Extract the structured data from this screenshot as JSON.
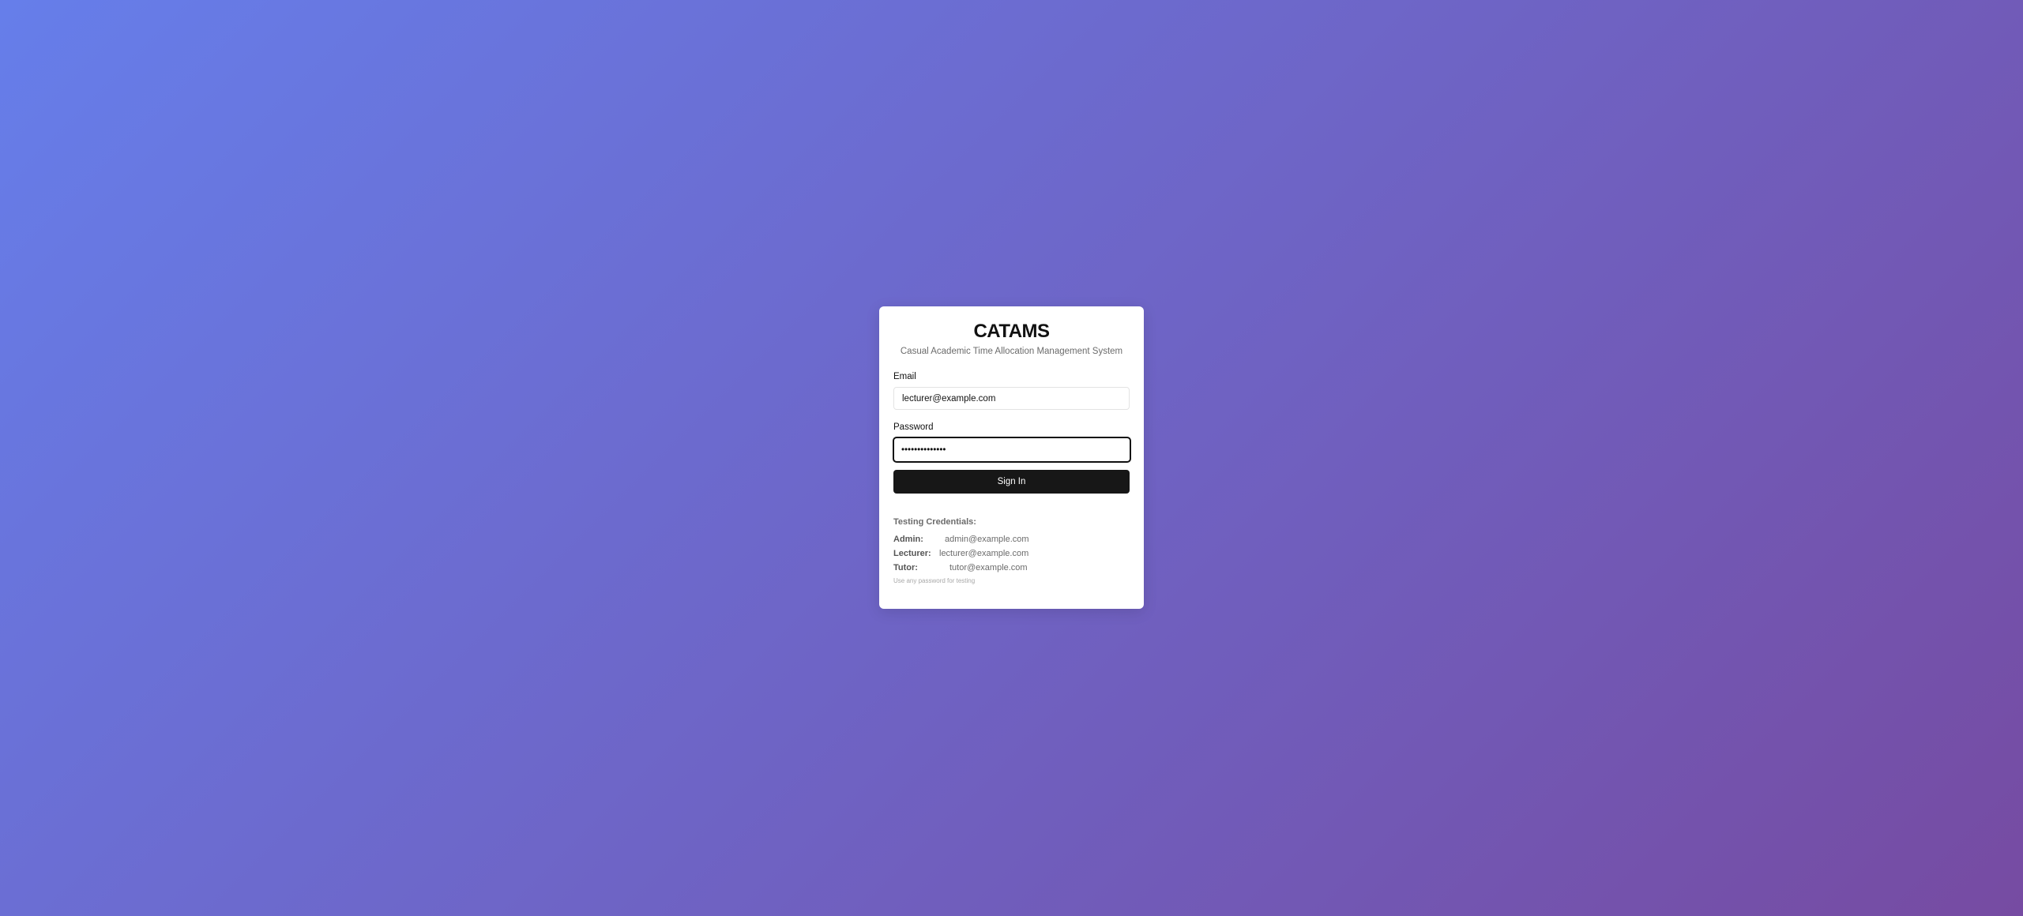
{
  "app": {
    "title": "CATAMS",
    "subtitle": "Casual Academic Time Allocation Management System"
  },
  "form": {
    "email_label": "Email",
    "email_value": "lecturer@example.com",
    "password_label": "Password",
    "password_value": "••••••••••••••",
    "submit_label": "Sign In"
  },
  "credentials": {
    "heading": "Testing Credentials:",
    "items": [
      {
        "role": "Admin:",
        "email": "admin@example.com"
      },
      {
        "role": "Lecturer:",
        "email": "lecturer@example.com"
      },
      {
        "role": "Tutor:",
        "email": "tutor@example.com"
      }
    ],
    "note": "Use any password for testing"
  },
  "colors": {
    "gradient_start": "#667eea",
    "gradient_end": "#764ba2",
    "button_bg": "#171717",
    "card_bg": "#ffffff"
  }
}
